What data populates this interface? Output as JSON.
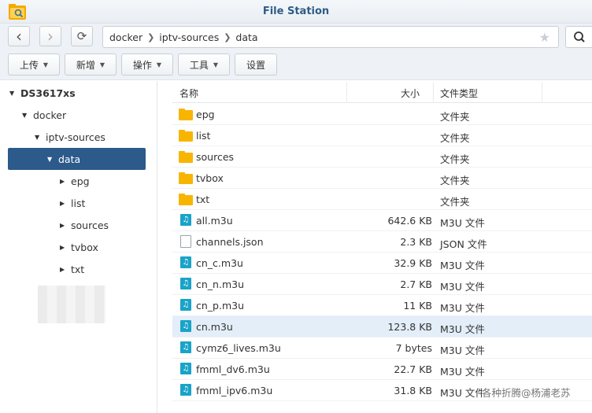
{
  "app": {
    "title": "File Station",
    "icon": "folder-app-icon"
  },
  "nav": {
    "back_icon": "‹",
    "forward_icon": "›",
    "refresh_icon": "⟳",
    "path": [
      "docker",
      "iptv-sources",
      "data"
    ],
    "star_icon": "★",
    "search_icon": "⚲"
  },
  "toolbar": {
    "upload": "上传",
    "create": "新增",
    "action": "操作",
    "tools": "工具",
    "settings": "设置"
  },
  "tree": {
    "root": "DS3617xs",
    "docker": "docker",
    "iptv_sources": "iptv-sources",
    "data": "data",
    "children": [
      "epg",
      "list",
      "sources",
      "tvbox",
      "txt"
    ]
  },
  "columns": {
    "name": "名称",
    "size": "大小",
    "type": "文件类型"
  },
  "files": [
    {
      "name": "epg",
      "size": "",
      "type": "文件夹",
      "icon": "folder"
    },
    {
      "name": "list",
      "size": "",
      "type": "文件夹",
      "icon": "folder"
    },
    {
      "name": "sources",
      "size": "",
      "type": "文件夹",
      "icon": "folder"
    },
    {
      "name": "tvbox",
      "size": "",
      "type": "文件夹",
      "icon": "folder"
    },
    {
      "name": "txt",
      "size": "",
      "type": "文件夹",
      "icon": "folder"
    },
    {
      "name": "all.m3u",
      "size": "642.6 KB",
      "type": "M3U 文件",
      "icon": "m3u"
    },
    {
      "name": "channels.json",
      "size": "2.3 KB",
      "type": "JSON 文件",
      "icon": "json"
    },
    {
      "name": "cn_c.m3u",
      "size": "32.9 KB",
      "type": "M3U 文件",
      "icon": "m3u"
    },
    {
      "name": "cn_n.m3u",
      "size": "2.7 KB",
      "type": "M3U 文件",
      "icon": "m3u"
    },
    {
      "name": "cn_p.m3u",
      "size": "11 KB",
      "type": "M3U 文件",
      "icon": "m3u"
    },
    {
      "name": "cn.m3u",
      "size": "123.8 KB",
      "type": "M3U 文件",
      "icon": "m3u"
    },
    {
      "name": "cymz6_lives.m3u",
      "size": "7 bytes",
      "type": "M3U 文件",
      "icon": "m3u"
    },
    {
      "name": "fmml_dv6.m3u",
      "size": "22.7 KB",
      "type": "M3U 文件",
      "icon": "m3u"
    },
    {
      "name": "fmml_ipv6.m3u",
      "size": "31.8 KB",
      "type": "M3U 文件",
      "icon": "m3u"
    }
  ],
  "selected_file": "cn.m3u",
  "watermark": "各种折腾@杨浦老苏",
  "colors": {
    "selection": "#2b5a8b",
    "row_selected": "#e3eef9",
    "folder": "#f7b500",
    "m3u": "#1aa3c8"
  }
}
